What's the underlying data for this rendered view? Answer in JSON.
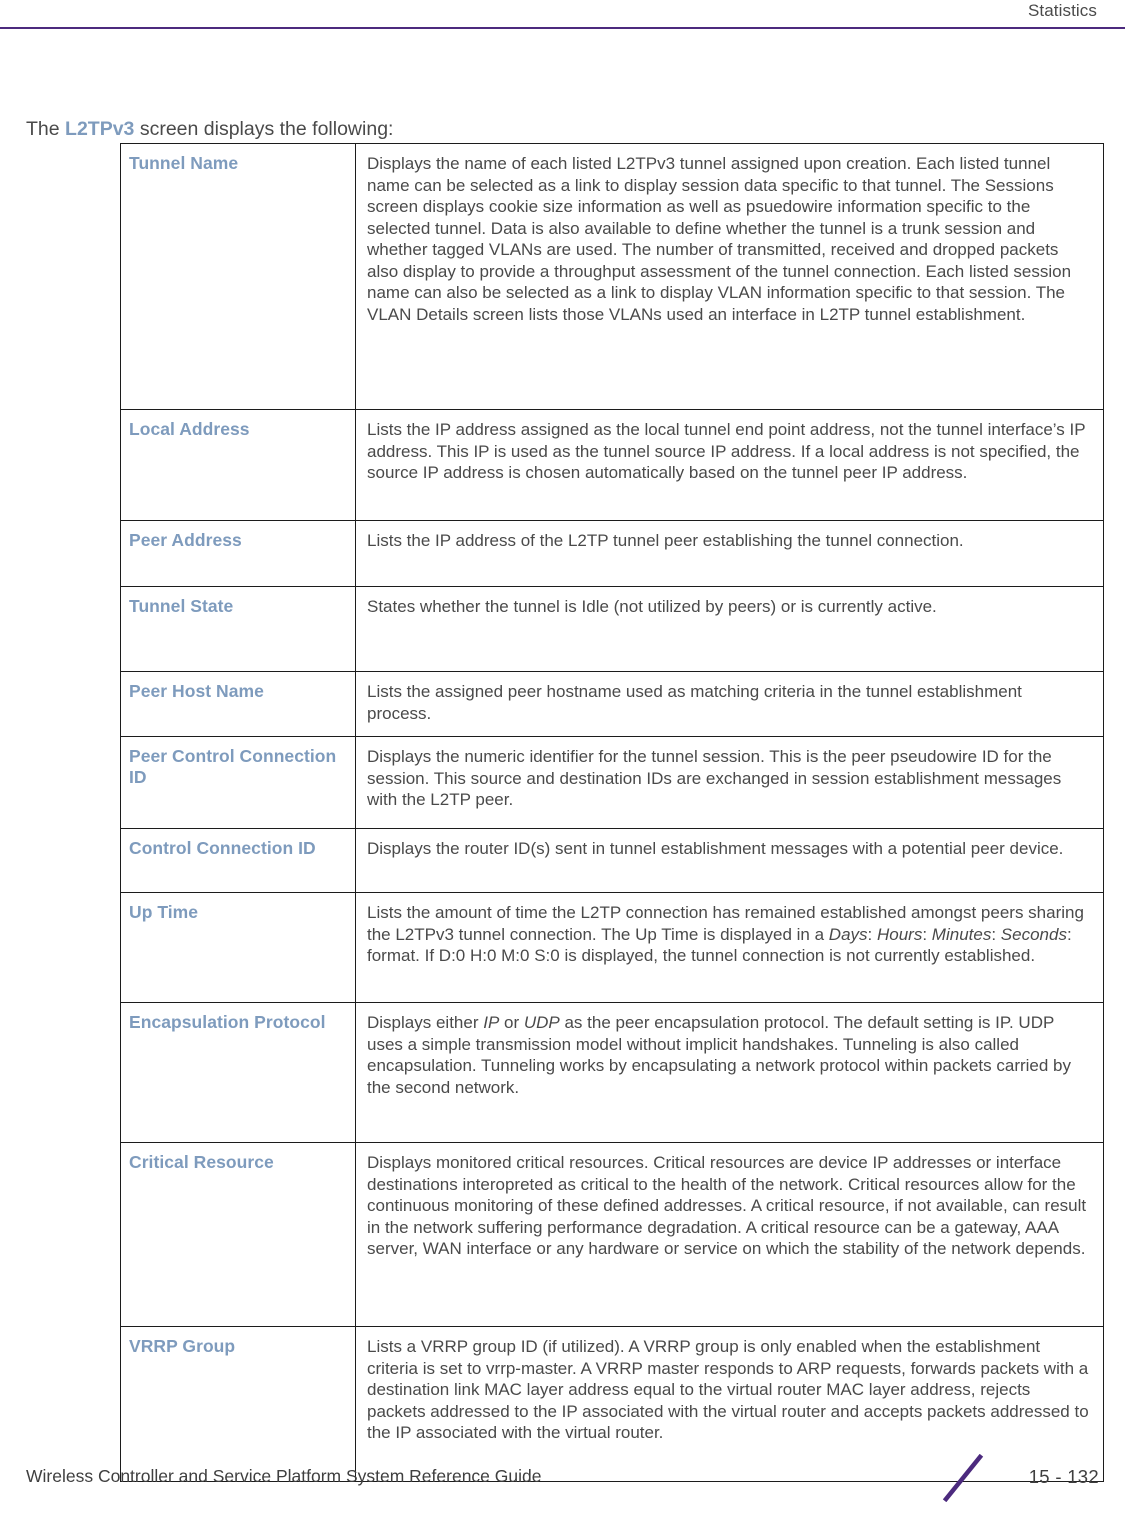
{
  "header": {
    "chapter_title": "Statistics",
    "rule_color": "#4C2A7E"
  },
  "intro": {
    "prefix": "The ",
    "screen_name": "L2TPv3",
    "suffix": " screen displays the following:"
  },
  "colors": {
    "term_blue": "#7E9BBD",
    "body_gray": "#4A4A4A",
    "accent_purple": "#4C2A7E",
    "table_border": "#1C1C1C"
  },
  "table": {
    "rows": [
      {
        "term": "Tunnel Name",
        "description": "Displays the name of each listed L2TPv3 tunnel assigned upon creation. Each listed tunnel name can be selected as a link to display session data specific to that tunnel. The Sessions screen displays cookie size information as well as psuedowire information specific to the selected tunnel. Data is also available to define whether the tunnel is a trunk session and whether tagged VLANs are used. The number of transmitted, received and dropped packets also display to provide a throughput assessment of the tunnel connection. Each listed session name can also be selected as a link to display VLAN information specific to that session. The VLAN Details screen lists those VLANs used an interface in L2TP tunnel establishment."
      },
      {
        "term": "Local Address",
        "description": "Lists the IP address assigned as the local tunnel end point address, not the tunnel interface’s IP address. This IP is used as the tunnel source IP address. If a local address is not specified, the source IP address is chosen automatically based on the tunnel peer IP address."
      },
      {
        "term": "Peer Address",
        "description": "Lists the IP address of the L2TP tunnel peer establishing the tunnel connection."
      },
      {
        "term": "Tunnel State",
        "description": "States whether the tunnel is Idle (not utilized by peers) or is currently active."
      },
      {
        "term": "Peer Host Name",
        "description": "Lists the assigned peer hostname used as matching criteria in the tunnel establishment process."
      },
      {
        "term": "Peer Control Connection ID",
        "description": "Displays the numeric identifier for the tunnel session. This is the peer pseudowire ID for the session. This source and destination IDs are exchanged in session establishment messages with the L2TP peer."
      },
      {
        "term": "Control Connection ID",
        "description": "Displays the router ID(s) sent in tunnel establishment messages with a potential peer device."
      },
      {
        "term": "Up Time",
        "description_html": "Lists the amount of time the L2TP connection has remained established amongst peers sharing the L2TPv3 tunnel connection. The Up Time is displayed in a <em>Days</em>: <em>Hours</em>: <em>Minutes</em>: <em>Seconds</em>: format. If D:0 H:0 M:0 S:0 is displayed, the tunnel connection is not currently established.",
        "description": "Lists the amount of time the L2TP connection has remained established amongst peers sharing the L2TPv3 tunnel connection. The Up Time is displayed in a Days: Hours: Minutes: Seconds: format. If D:0 H:0 M:0 S:0 is displayed, the tunnel connection is not currently established."
      },
      {
        "term": "Encapsulation Protocol",
        "description_html": "Displays either <em>IP</em> or <em>UDP</em> as the peer encapsulation protocol. The default setting is IP. UDP uses a simple transmission model without implicit handshakes. Tunneling is also called encapsulation. Tunneling works by encapsulating a network protocol within packets carried by the second network.",
        "description": "Displays either IP or UDP as the peer encapsulation protocol. The default setting is IP. UDP uses a simple transmission model without implicit handshakes. Tunneling is also called encapsulation. Tunneling works by encapsulating a network protocol within packets carried by the second network."
      },
      {
        "term": "Critical Resource",
        "description": "Displays monitored critical resources. Critical resources are device IP addresses or interface destinations interopreted as critical to the health of the network. Critical resources allow for the continuous monitoring of these defined addresses. A critical resource, if not available, can result in the network suffering performance degradation. A critical resource can be a gateway, AAA server, WAN interface or any hardware or service on which the stability of the network depends."
      },
      {
        "term": "VRRP Group",
        "description": "Lists a VRRP group ID (if utilized). A VRRP group is only enabled when the establishment criteria is set to vrrp-master. A VRRP master responds to ARP requests, forwards packets with a destination link MAC layer address equal to the virtual router MAC layer address, rejects packets addressed to the IP associated with the virtual router and accepts packets addressed to the IP associated with the virtual router."
      }
    ]
  },
  "footer": {
    "guide_title": "Wireless Controller and Service Platform System Reference Guide",
    "page_number": "15 - 132",
    "slash_icon": "diagonal-slash-icon"
  }
}
